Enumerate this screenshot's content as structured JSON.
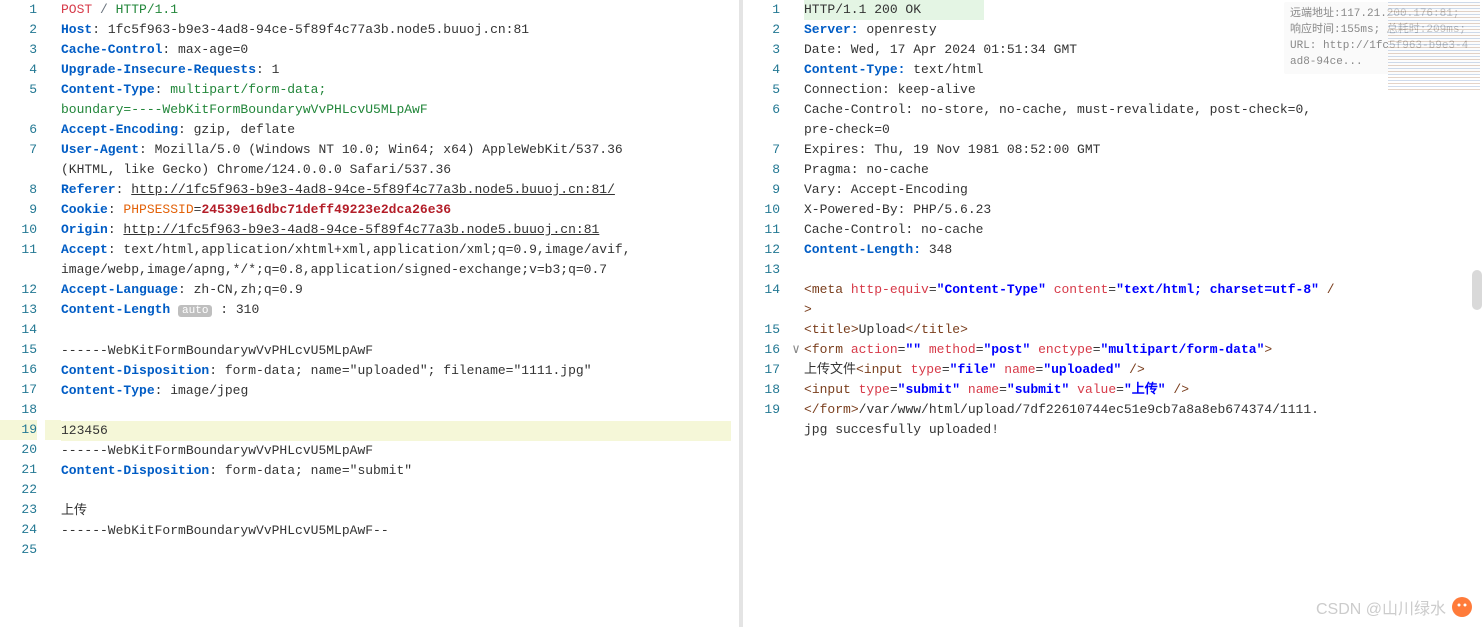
{
  "request": {
    "lines": [
      {
        "n": 1,
        "tokens": [
          {
            "t": "POST",
            "c": "red"
          },
          {
            "t": " · / · ",
            "c": "gray"
          },
          {
            "t": "HTTP/1.1",
            "c": "green"
          }
        ]
      },
      {
        "n": 2,
        "tokens": [
          {
            "t": "Host",
            "c": "kw"
          },
          {
            "t": ": · 1fc5f963-b9e3-4ad8-94ce-5f89f4c77a3b.node5.buuoj.cn:81",
            "c": "plain"
          }
        ]
      },
      {
        "n": 3,
        "tokens": [
          {
            "t": "Cache-Control",
            "c": "kw"
          },
          {
            "t": ": · max-age=0",
            "c": "plain"
          }
        ]
      },
      {
        "n": 4,
        "tokens": [
          {
            "t": "Upgrade-Insecure-Requests",
            "c": "kw"
          },
          {
            "t": ": · 1",
            "c": "plain"
          }
        ]
      },
      {
        "n": 5,
        "tokens": [
          {
            "t": "Content-Type",
            "c": "kw"
          },
          {
            "t": ": · ",
            "c": "plain"
          },
          {
            "t": "multipart/form-data; · ",
            "c": "green"
          }
        ]
      },
      {
        "n": "",
        "tokens": [
          {
            "t": "boundary=----WebKitFormBoundarywVvPHLcvU5MLpAwF",
            "c": "green"
          }
        ]
      },
      {
        "n": 6,
        "tokens": [
          {
            "t": "Accept-Encoding",
            "c": "kw"
          },
          {
            "t": ": · gzip, · deflate",
            "c": "plain"
          }
        ]
      },
      {
        "n": 7,
        "tokens": [
          {
            "t": "User-Agent",
            "c": "kw"
          },
          {
            "t": ": · Mozilla/5.0 · (Windows · NT · 10.0; · Win64; · x64) · AppleWebKit/537.36 · ",
            "c": "plain"
          }
        ]
      },
      {
        "n": "",
        "tokens": [
          {
            "t": "(KHTML, · like · Gecko) · Chrome/124.0.0.0 · Safari/537.36",
            "c": "plain"
          }
        ]
      },
      {
        "n": 8,
        "tokens": [
          {
            "t": "Referer",
            "c": "kw"
          },
          {
            "t": ": · ",
            "c": "plain"
          },
          {
            "t": "http://1fc5f963-b9e3-4ad8-94ce-5f89f4c77a3b.node5.buuoj.cn:81/",
            "c": "link"
          }
        ]
      },
      {
        "n": 9,
        "tokens": [
          {
            "t": "Cookie",
            "c": "kw"
          },
          {
            "t": ": · ",
            "c": "plain"
          },
          {
            "t": "PHPSESSID",
            "c": "attr"
          },
          {
            "t": "=",
            "c": "plain"
          },
          {
            "t": "24539e16dbc71deff49223e2dca26e36",
            "c": "cookieval"
          }
        ]
      },
      {
        "n": 10,
        "tokens": [
          {
            "t": "Origin",
            "c": "kw"
          },
          {
            "t": ": · ",
            "c": "plain"
          },
          {
            "t": "http://1fc5f963-b9e3-4ad8-94ce-5f89f4c77a3b.node5.buuoj.cn:81",
            "c": "link"
          }
        ]
      },
      {
        "n": 11,
        "tokens": [
          {
            "t": "Accept",
            "c": "kw"
          },
          {
            "t": ": · text/html,application/xhtml+xml,application/xml;q=0.9,image/avif,",
            "c": "plain"
          }
        ]
      },
      {
        "n": "",
        "tokens": [
          {
            "t": "image/webp,image/apng,*/*;q=0.8,application/signed-exchange;v=b3;q=0.7",
            "c": "plain"
          }
        ]
      },
      {
        "n": 12,
        "tokens": [
          {
            "t": "Accept-Language",
            "c": "kw"
          },
          {
            "t": ": · zh-CN,zh;q=0.9",
            "c": "plain"
          }
        ]
      },
      {
        "n": 13,
        "tokens": [
          {
            "t": "Content-Length",
            "c": "kw"
          },
          {
            "t": " ",
            "c": "plain"
          },
          {
            "t": "auto",
            "c": "badge"
          },
          {
            "t": " : · 310",
            "c": "plain"
          }
        ]
      },
      {
        "n": 14,
        "tokens": []
      },
      {
        "n": 15,
        "tokens": [
          {
            "t": "------WebKitFormBoundarywVvPHLcvU5MLpAwF",
            "c": "plain"
          }
        ]
      },
      {
        "n": 16,
        "tokens": [
          {
            "t": "Content-Disposition",
            "c": "kw"
          },
          {
            "t": ": · form-data; · name=\"uploaded\"; · filename=\"1111.jpg\"",
            "c": "plain"
          }
        ]
      },
      {
        "n": 17,
        "tokens": [
          {
            "t": "Content-Type",
            "c": "kw"
          },
          {
            "t": ": · image/jpeg",
            "c": "plain"
          }
        ]
      },
      {
        "n": 18,
        "tokens": []
      },
      {
        "n": 19,
        "hl": true,
        "tokens": [
          {
            "t": "123456",
            "c": "plain"
          }
        ]
      },
      {
        "n": 20,
        "tokens": [
          {
            "t": "------WebKitFormBoundarywVvPHLcvU5MLpAwF",
            "c": "plain"
          }
        ]
      },
      {
        "n": 21,
        "tokens": [
          {
            "t": "Content-Disposition",
            "c": "kw"
          },
          {
            "t": ": · form-data; · name=\"submit\"",
            "c": "plain"
          }
        ]
      },
      {
        "n": 22,
        "tokens": []
      },
      {
        "n": 23,
        "tokens": [
          {
            "t": "上传",
            "c": "plain"
          }
        ]
      },
      {
        "n": 24,
        "tokens": [
          {
            "t": "------WebKitFormBoundarywVvPHLcvU5MLpAwF--",
            "c": "plain"
          }
        ]
      },
      {
        "n": 25,
        "tokens": []
      }
    ]
  },
  "response": {
    "info": "远端地址:117.21.200.176:81; 响应时间:155ms; 总耗时:209ms; URL: http://1fc5f963-b9e3-4ad8-94ce...",
    "lines": [
      {
        "n": 1,
        "hl1": true,
        "tokens": [
          {
            "t": "HTTP/1.1 · 200 · OK",
            "c": "plain"
          }
        ]
      },
      {
        "n": 2,
        "tokens": [
          {
            "t": "Server: · ",
            "c": "kw"
          },
          {
            "t": "openresty",
            "c": "plain"
          }
        ]
      },
      {
        "n": 3,
        "tokens": [
          {
            "t": "Date: · Wed, · 17 · Apr · 2024 · 01:51:34 · GMT",
            "c": "plain"
          }
        ]
      },
      {
        "n": 4,
        "tokens": [
          {
            "t": "Content-Type: · ",
            "c": "kw"
          },
          {
            "t": "text/html",
            "c": "plain"
          }
        ]
      },
      {
        "n": 5,
        "tokens": [
          {
            "t": "Connection: · keep-alive",
            "c": "plain"
          }
        ]
      },
      {
        "n": 6,
        "tokens": [
          {
            "t": "Cache-Control: · no-store, · no-cache, · must-revalidate, · post-check=0, · ",
            "c": "plain"
          }
        ]
      },
      {
        "n": "",
        "tokens": [
          {
            "t": "pre-check=0",
            "c": "plain"
          }
        ]
      },
      {
        "n": 7,
        "tokens": [
          {
            "t": "Expires: · Thu, · 19 · Nov · 1981 · 08:52:00 · GMT",
            "c": "plain"
          }
        ]
      },
      {
        "n": 8,
        "tokens": [
          {
            "t": "Pragma: · no-cache",
            "c": "plain"
          }
        ]
      },
      {
        "n": 9,
        "tokens": [
          {
            "t": "Vary: · Accept-Encoding",
            "c": "plain"
          }
        ]
      },
      {
        "n": 10,
        "tokens": [
          {
            "t": "X-Powered-By: · PHP/5.6.23",
            "c": "plain"
          }
        ]
      },
      {
        "n": 11,
        "tokens": [
          {
            "t": "Cache-Control: · no-cache",
            "c": "plain"
          }
        ]
      },
      {
        "n": 12,
        "tokens": [
          {
            "t": "Content-Length: · ",
            "c": "kw"
          },
          {
            "t": "348",
            "c": "plain"
          }
        ]
      },
      {
        "n": 13,
        "tokens": []
      },
      {
        "n": 14,
        "tokens": [
          {
            "t": "<",
            "c": "brown"
          },
          {
            "t": "meta · ",
            "c": "brown"
          },
          {
            "t": "http-equiv",
            "c": "red"
          },
          {
            "t": "=",
            "c": "plain"
          },
          {
            "t": "\"Content-Type\"",
            "c": "blueb"
          },
          {
            "t": " · ",
            "c": "plain"
          },
          {
            "t": "content",
            "c": "red"
          },
          {
            "t": "=",
            "c": "plain"
          },
          {
            "t": "\"text/html; · charset=utf-8\"",
            "c": "blueb"
          },
          {
            "t": " · /",
            "c": "brown"
          }
        ]
      },
      {
        "n": "",
        "tokens": [
          {
            "t": ">",
            "c": "brown"
          }
        ]
      },
      {
        "n": 15,
        "tokens": [
          {
            "t": "<",
            "c": "brown"
          },
          {
            "t": "title",
            "c": "brown"
          },
          {
            "t": ">",
            "c": "brown"
          },
          {
            "t": "Upload",
            "c": "plain"
          },
          {
            "t": "</",
            "c": "brown"
          },
          {
            "t": "title",
            "c": "brown"
          },
          {
            "t": ">",
            "c": "brown"
          }
        ]
      },
      {
        "n": 16,
        "fold": "∨",
        "tokens": [
          {
            "t": "<",
            "c": "brown"
          },
          {
            "t": "form · ",
            "c": "brown"
          },
          {
            "t": "action",
            "c": "red"
          },
          {
            "t": "=",
            "c": "plain"
          },
          {
            "t": "\"\"",
            "c": "blueb"
          },
          {
            "t": " · ",
            "c": "plain"
          },
          {
            "t": "method",
            "c": "red"
          },
          {
            "t": "=",
            "c": "plain"
          },
          {
            "t": "\"post\"",
            "c": "blueb"
          },
          {
            "t": " · ",
            "c": "plain"
          },
          {
            "t": "enctype",
            "c": "red"
          },
          {
            "t": "=",
            "c": "plain"
          },
          {
            "t": "\"multipart/form-data\"",
            "c": "blueb"
          },
          {
            "t": ">",
            "c": "brown"
          }
        ]
      },
      {
        "n": 17,
        "tokens": [
          {
            "t": "上传文件",
            "c": "plain"
          },
          {
            "t": "<",
            "c": "brown"
          },
          {
            "t": "input · ",
            "c": "brown"
          },
          {
            "t": "type",
            "c": "red"
          },
          {
            "t": "=",
            "c": "plain"
          },
          {
            "t": "\"file\"",
            "c": "blueb"
          },
          {
            "t": " · ",
            "c": "plain"
          },
          {
            "t": "name",
            "c": "red"
          },
          {
            "t": "=",
            "c": "plain"
          },
          {
            "t": "\"uploaded\"",
            "c": "blueb"
          },
          {
            "t": " · />",
            "c": "brown"
          }
        ]
      },
      {
        "n": 18,
        "tokens": [
          {
            "t": "<",
            "c": "brown"
          },
          {
            "t": "input · ",
            "c": "brown"
          },
          {
            "t": "type",
            "c": "red"
          },
          {
            "t": "=",
            "c": "plain"
          },
          {
            "t": "\"submit\"",
            "c": "blueb"
          },
          {
            "t": " · ",
            "c": "plain"
          },
          {
            "t": "name",
            "c": "red"
          },
          {
            "t": "=",
            "c": "plain"
          },
          {
            "t": "\"submit\"",
            "c": "blueb"
          },
          {
            "t": " · ",
            "c": "plain"
          },
          {
            "t": "value",
            "c": "red"
          },
          {
            "t": "=",
            "c": "plain"
          },
          {
            "t": "\"上传\"",
            "c": "blueb"
          },
          {
            "t": " · />",
            "c": "brown"
          }
        ]
      },
      {
        "n": 19,
        "tokens": [
          {
            "t": "</",
            "c": "brown"
          },
          {
            "t": "form",
            "c": "brown"
          },
          {
            "t": ">",
            "c": "brown"
          },
          {
            "t": "/var/www/html/upload/7df22610744ec51e9cb7a8a8eb674374/1111.",
            "c": "plain"
          }
        ]
      },
      {
        "n": "",
        "tokens": [
          {
            "t": "jpg · succesfully · uploaded!",
            "c": "plain"
          }
        ]
      }
    ]
  },
  "watermark": "CSDN @山川绿水"
}
